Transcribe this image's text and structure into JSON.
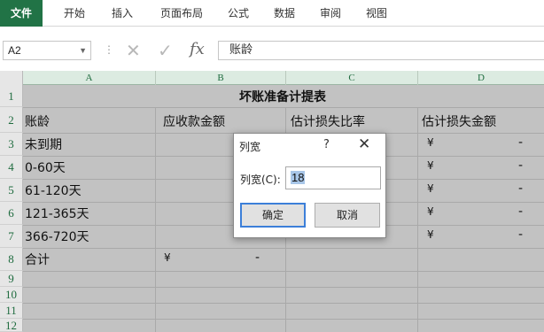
{
  "ribbon": {
    "tabs": [
      "文件",
      "开始",
      "插入",
      "页面布局",
      "公式",
      "数据",
      "审阅",
      "视图"
    ]
  },
  "formula_bar": {
    "name_box": "A2",
    "formula": "账龄"
  },
  "columns": [
    "A",
    "B",
    "C",
    "D"
  ],
  "rows": [
    "1",
    "2",
    "3",
    "4",
    "5",
    "6",
    "7",
    "8",
    "9",
    "10",
    "11",
    "12"
  ],
  "sheet": {
    "title": "坏账准备计提表",
    "headers": [
      "账龄",
      "应收款金额",
      "估计损失比率",
      "估计损失金额"
    ],
    "aging": [
      "未到期",
      "0-60天",
      "61-120天",
      "121-365天",
      "366-720天",
      "合计"
    ],
    "currency": "¥",
    "dash": "-"
  },
  "dialog": {
    "title": "列宽",
    "help": "?",
    "close": "✕",
    "label": "列宽(C):",
    "value": "18",
    "ok": "确定",
    "cancel": "取消"
  },
  "colors": {
    "accent": "#217346",
    "grid_bg": "#c2c2c2"
  }
}
